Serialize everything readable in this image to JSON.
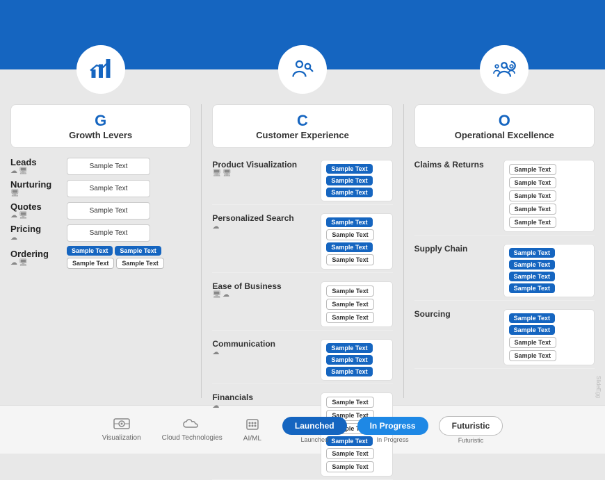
{
  "banner": {
    "icons": [
      {
        "name": "growth-icon",
        "column": "G"
      },
      {
        "name": "customer-icon",
        "column": "C"
      },
      {
        "name": "operational-icon",
        "column": "O"
      }
    ]
  },
  "columns": {
    "left": {
      "letter": "G",
      "title": "Growth Levers",
      "rows": [
        {
          "label": "Leads",
          "icons": "☁ 🖥",
          "badge_type": "single",
          "badge_text": "Sample Text"
        },
        {
          "label": "Nurturing",
          "icons": "🖥",
          "badge_type": "single",
          "badge_text": "Sample Text"
        },
        {
          "label": "Quotes",
          "icons": "☁ 🖥",
          "badge_type": "single",
          "badge_text": "Sample Text"
        },
        {
          "label": "Pricing",
          "icons": "☁",
          "badge_type": "single",
          "badge_text": "Sample Text"
        },
        {
          "label": "Ordering",
          "icons": "☁ 🖥",
          "badge_type": "multi",
          "badges": [
            "Sample Text",
            "Sample Text",
            "Sample Text",
            "Sample Text"
          ]
        }
      ]
    },
    "middle": {
      "letter": "C",
      "title": "Customer Experience",
      "rows": [
        {
          "label": "Product Visualization",
          "icons": "🖥 🖥",
          "badges": [
            "Sample Text",
            "Sample Text",
            "Sample Text"
          ]
        },
        {
          "label": "Personalized Search",
          "icons": "☁",
          "badges": [
            "Sample Text",
            "Sample Text",
            "Sample Text",
            "Sample Text"
          ]
        },
        {
          "label": "Ease of Business",
          "icons": "🖥 ☁",
          "badges": [
            "Sample Text",
            "Sample Text",
            "Sample Text"
          ]
        },
        {
          "label": "Communication",
          "icons": "☁",
          "badges": [
            "Sample Text",
            "Sample Text",
            "Sample Text"
          ]
        },
        {
          "label": "Financials",
          "icons": "☁",
          "badges": [
            "Sample Text",
            "Sample Text",
            "Sample Text",
            "Sample Text",
            "Sample Text",
            "Sample Text"
          ]
        }
      ]
    },
    "right": {
      "letter": "O",
      "title": "Operational Excellence",
      "rows": [
        {
          "label": "Claims & Returns",
          "badges": [
            "Sample Text",
            "Sample Text",
            "Sample Text",
            "Sample Text",
            "Sample Text"
          ]
        },
        {
          "label": "Supply Chain",
          "badges": [
            "Sample Text",
            "Sample Text",
            "Sample Text",
            "Sample Text"
          ]
        },
        {
          "label": "Sourcing",
          "badges": [
            "Sample Text",
            "Sample Text",
            "Sample Text",
            "Sample Text"
          ]
        }
      ]
    }
  },
  "footer": {
    "icons": [
      {
        "label": "Visualization",
        "icon": "👁"
      },
      {
        "label": "Cloud Technologies",
        "icon": "☁"
      },
      {
        "label": "AI/ML",
        "icon": "⚙"
      }
    ],
    "legend": [
      {
        "label": "Launched",
        "style": "blue"
      },
      {
        "label": "In Progress",
        "style": "teal"
      },
      {
        "label": "Futuristic",
        "style": "outline"
      }
    ]
  },
  "watermark": "SlideEgg"
}
